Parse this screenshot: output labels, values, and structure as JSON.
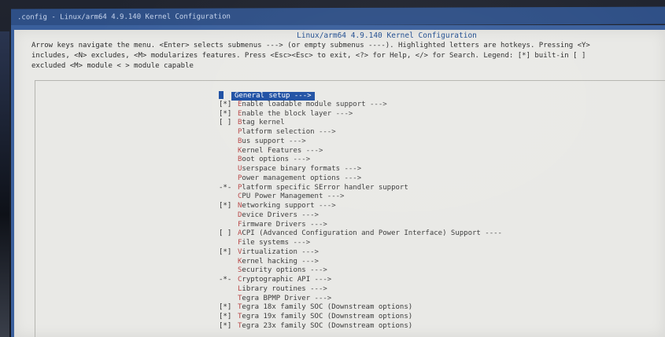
{
  "window": {
    "title": ".config - Linux/arm64 4.9.140 Kernel Configuration"
  },
  "dialog": {
    "title": "Linux/arm64 4.9.140 Kernel Configuration",
    "help_lines": [
      "Arrow keys navigate the menu.  <Enter> selects submenus ---> (or empty submenus ----).  Highlighted letters are hotkeys.  Pressing <Y>",
      "includes, <N> excludes, <M> modularizes features.  Press <Esc><Esc> to exit, <?> for Help, </> for Search.  Legend: [*] built-in  [ ]",
      "excluded  <M> module  < > module capable"
    ]
  },
  "menu": {
    "items": [
      {
        "prefix": "",
        "hotkey": "G",
        "rest": "eneral setup",
        "arrow": "--->",
        "selected": true
      },
      {
        "prefix": "[*]",
        "hotkey": "E",
        "rest": "nable loadable module support",
        "arrow": "--->"
      },
      {
        "prefix": "[*]",
        "hotkey": "E",
        "rest": "nable the block layer",
        "arrow": "--->"
      },
      {
        "prefix": "[ ]",
        "hotkey": "B",
        "rest": "tag kernel",
        "arrow": ""
      },
      {
        "prefix": "",
        "hotkey": "P",
        "rest": "latform selection",
        "arrow": "--->"
      },
      {
        "prefix": "",
        "hotkey": "B",
        "rest": "us support",
        "arrow": "--->"
      },
      {
        "prefix": "",
        "hotkey": "K",
        "rest": "ernel Features",
        "arrow": "--->"
      },
      {
        "prefix": "",
        "hotkey": "B",
        "rest": "oot options",
        "arrow": "--->"
      },
      {
        "prefix": "",
        "hotkey": "U",
        "rest": "serspace binary formats",
        "arrow": "--->"
      },
      {
        "prefix": "",
        "hotkey": "P",
        "rest": "ower management options",
        "arrow": "--->"
      },
      {
        "prefix": "-*-",
        "hotkey": "P",
        "rest": "latform specific SError handler support",
        "arrow": ""
      },
      {
        "prefix": "",
        "hotkey": "C",
        "rest": "PU Power Management",
        "arrow": "--->"
      },
      {
        "prefix": "[*]",
        "hotkey": "N",
        "rest": "etworking support",
        "arrow": "--->"
      },
      {
        "prefix": "",
        "hotkey": "D",
        "rest": "evice Drivers",
        "arrow": "--->"
      },
      {
        "prefix": "",
        "hotkey": "F",
        "rest": "irmware Drivers",
        "arrow": "--->"
      },
      {
        "prefix": "[ ]",
        "hotkey": "A",
        "rest": "CPI (Advanced Configuration and Power Interface) Support",
        "arrow": "----"
      },
      {
        "prefix": "",
        "hotkey": "F",
        "rest": "ile systems",
        "arrow": "--->"
      },
      {
        "prefix": "[*]",
        "hotkey": "V",
        "rest": "irtualization",
        "arrow": "--->"
      },
      {
        "prefix": "",
        "hotkey": "K",
        "rest": "ernel hacking",
        "arrow": "--->"
      },
      {
        "prefix": "",
        "hotkey": "S",
        "rest": "ecurity options",
        "arrow": "--->"
      },
      {
        "prefix": "-*-",
        "hotkey": "C",
        "rest": "ryptographic API",
        "arrow": "--->"
      },
      {
        "prefix": "",
        "hotkey": "L",
        "rest": "ibrary routines",
        "arrow": "--->"
      },
      {
        "prefix": "",
        "hotkey": "T",
        "rest": "egra BPMP Driver",
        "arrow": "--->"
      },
      {
        "prefix": "[*]",
        "hotkey": "T",
        "rest": "egra 18x family SOC (Downstream options)",
        "arrow": ""
      },
      {
        "prefix": "[*]",
        "hotkey": "T",
        "rest": "egra 19x family SOC (Downstream options)",
        "arrow": ""
      },
      {
        "prefix": "[*]",
        "hotkey": "T",
        "rest": "egra 23x family SOC (Downstream options)",
        "arrow": ""
      }
    ]
  },
  "colors": {
    "backdrop": "#3a5f9c",
    "dialog": "#e9e9e6",
    "selection": "#1d4fa3",
    "hotkey": "#b84848",
    "title_text": "#1f4c8f"
  }
}
